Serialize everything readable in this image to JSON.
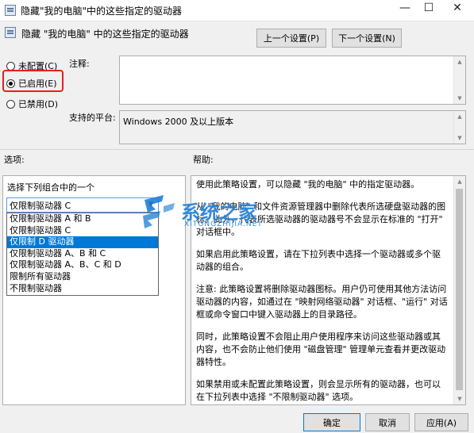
{
  "window": {
    "title": "隐藏\"我的电脑\"中的这些指定的驱动器",
    "minimize_glyph": "—",
    "maximize_glyph": "☐",
    "close_glyph": "✕"
  },
  "header": {
    "title": "隐藏 \"我的电脑\" 中的这些指定的驱动器",
    "prev_label": "上一个设置(P)",
    "next_label": "下一个设置(N)"
  },
  "state": {
    "options": [
      {
        "label": "未配置(C)",
        "checked": false
      },
      {
        "label": "已启用(E)",
        "checked": true
      },
      {
        "label": "已禁用(D)",
        "checked": false
      }
    ]
  },
  "comment": {
    "label": "注释:",
    "value": ""
  },
  "platform": {
    "label": "支持的平台:",
    "value": "Windows 2000 及以上版本"
  },
  "options_section": {
    "label": "选项:",
    "prompt": "选择下列组合中的一个",
    "selected": "仅限制驱动器 C",
    "items": [
      "仅限制驱动器 A 和 B",
      "仅限制驱动器 C",
      "仅限制 D 驱动器",
      "仅限制驱动器 A、B 和 C",
      "仅限制驱动器 A、B、C 和 D",
      "限制所有驱动器",
      "不限制驱动器"
    ],
    "highlighted_index": 2
  },
  "help_section": {
    "label": "帮助:",
    "paragraphs": [
      "使用此策略设置，可以隐藏 \"我的电脑\" 中的指定驱动器。",
      "从 \"我的电脑\" 和文件资源管理器中删除代表所选硬盘驱动器的图标。此外，代表所选驱动器的驱动器号不会显示在标准的 \"打开\" 对话框中。",
      "如果启用此策略设置，请在下拉列表中选择一个驱动器或多个驱动器的组合。",
      "注意: 此策略设置将删除驱动器图标。用户仍可使用其他方法访问驱动器的内容，如通过在 \"映射网络驱动器\" 对话框、\"运行\" 对话框或命令窗口中键入驱动器上的目录路径。",
      "同时，此策略设置不会阻止用户使用程序来访问这些驱动器或其内容，也不会防止他们使用 \"磁盘管理\" 管理单元查看并更改驱动器特性。",
      "如果禁用或未配置此策略设置，则会显示所有的驱动器，也可以在下拉列表中选择 \"不限制驱动器\" 选项。"
    ]
  },
  "footer": {
    "ok_label": "确定",
    "cancel_label": "取消",
    "apply_label": "应用(A)"
  },
  "watermark": {
    "text": "系统之家",
    "subtext": "XITONGZHIJIA.NET"
  },
  "colors": {
    "highlight_box": "#e5201f",
    "selection": "#0078d7",
    "watermark_blue": "#1f7fd6"
  }
}
